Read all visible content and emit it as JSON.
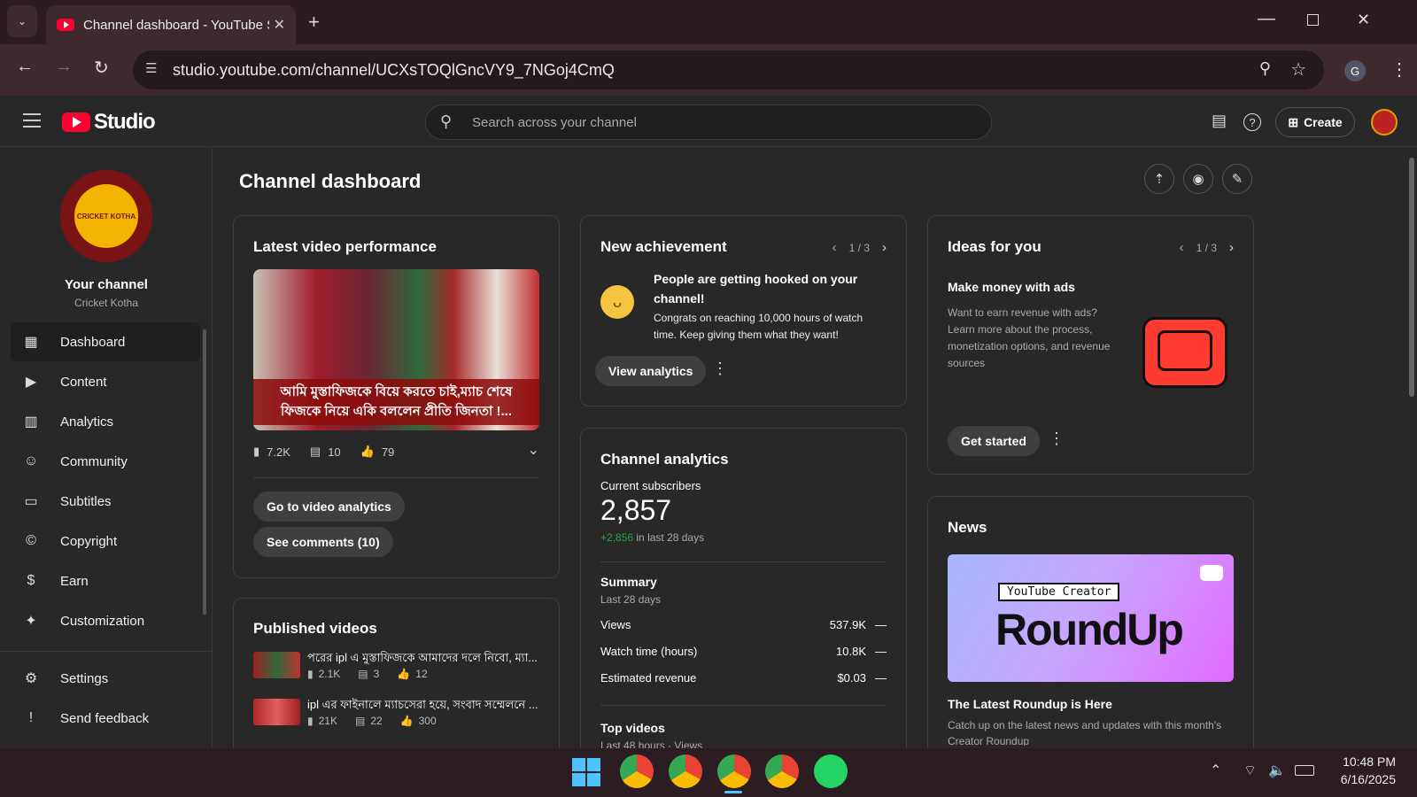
{
  "browser": {
    "tab_title": "Channel dashboard - YouTube Studio",
    "url": "studio.youtube.com/channel/UCXsTOQlGncVY9_7NGoj4CmQ",
    "profile_initial": "G"
  },
  "header": {
    "logo_text": "Studio",
    "search_placeholder": "Search across your channel",
    "create_label": "Create"
  },
  "sidebar": {
    "channel_heading": "Your channel",
    "channel_name": "Cricket Kotha",
    "avatar_text": "CRICKET KOTHA",
    "items": [
      {
        "label": "Dashboard"
      },
      {
        "label": "Content"
      },
      {
        "label": "Analytics"
      },
      {
        "label": "Community"
      },
      {
        "label": "Subtitles"
      },
      {
        "label": "Copyright"
      },
      {
        "label": "Earn"
      },
      {
        "label": "Customization"
      }
    ],
    "bottom_items": [
      {
        "label": "Settings"
      },
      {
        "label": "Send feedback"
      }
    ]
  },
  "page": {
    "title": "Channel dashboard"
  },
  "latest_video": {
    "heading": "Latest video performance",
    "thumb_caption": "আমি মুস্তাফিজকে বিয়ে করতে চাই,ম্যাচ শেষে ফিজকে নিয়ে একি বললেন প্রীতি জিনতা !...",
    "views": "7.2K",
    "comments": "10",
    "likes": "79",
    "btn_analytics": "Go to video analytics",
    "btn_comments": "See comments (10)"
  },
  "published": {
    "heading": "Published videos",
    "videos": [
      {
        "title": "পরের ipl এ মুস্তাফিজকে আমাদের দলে নিবো, ম্যা...",
        "views": "2.1K",
        "comments": "3",
        "likes": "12"
      },
      {
        "title": "ipl এর ফাইনালে ম্যাচসেরা হয়ে, সংবাদ সম্মেলনে ...",
        "views": "21K",
        "comments": "22",
        "likes": "300"
      }
    ]
  },
  "achievement": {
    "heading": "New achievement",
    "pager": "1 / 3",
    "title": "People are getting hooked on your channel!",
    "body": "Congrats on reaching 10,000 hours of watch time. Keep giving them what they want!",
    "btn": "View analytics"
  },
  "analytics": {
    "heading": "Channel analytics",
    "subs_label": "Current subscribers",
    "subs_value": "2,857",
    "subs_delta": "+2,856",
    "subs_delta_suffix": "in last 28 days",
    "summary_label": "Summary",
    "summary_period": "Last 28 days",
    "rows": [
      {
        "label": "Views",
        "value": "537.9K",
        "trend": "—"
      },
      {
        "label": "Watch time (hours)",
        "value": "10.8K",
        "trend": "—"
      },
      {
        "label": "Estimated revenue",
        "value": "$0.03",
        "trend": "—"
      }
    ],
    "top_videos": "Top videos",
    "top_period": "Last 48 hours · Views"
  },
  "ideas": {
    "heading": "Ideas for you",
    "pager": "1 / 3",
    "title": "Make money with ads",
    "body": "Want to earn revenue with ads? Learn more about the process, monetization options, and revenue sources",
    "btn": "Get started"
  },
  "news": {
    "heading": "News",
    "banner_tag": "YouTube Creator",
    "banner_title": "RoundUp",
    "title": "The Latest Roundup is Here",
    "body": "Catch up on the latest news and updates with this month's Creator Roundup"
  },
  "taskbar": {
    "time": "10:48 PM",
    "date": "6/16/2025"
  },
  "colors": {
    "accent": "#ff0033",
    "positive": "#2ba640"
  }
}
